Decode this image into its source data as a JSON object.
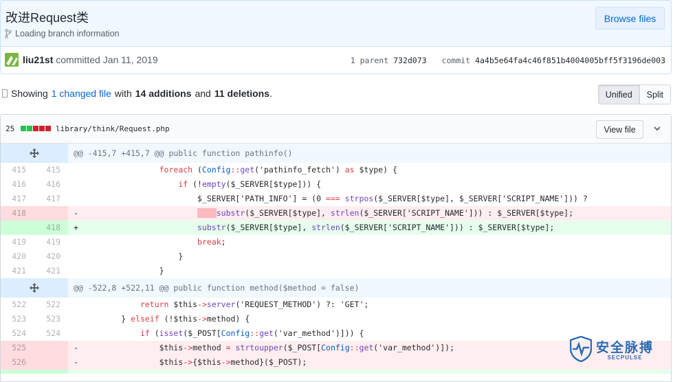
{
  "commit": {
    "title": "改进Request类",
    "branch_info": "Loading branch information",
    "browse_files": "Browse files",
    "author": "liu21st",
    "committed_text": "committed Jan 11, 2019",
    "parent_label": "1 parent",
    "parent_sha": "732d073",
    "commit_label": "commit",
    "commit_sha": "4a4b5e64fa4c46f851b4004005bff5f3196de003"
  },
  "toolbar": {
    "showing": "Showing",
    "changed_link": "1 changed file",
    "with": "with",
    "additions": "14 additions",
    "and": "and",
    "deletions": "11 deletions",
    "period": ".",
    "unified": "Unified",
    "split": "Split"
  },
  "file": {
    "change_count": "25",
    "path": "library/think/Request.php",
    "view_file": "View file",
    "diffstat_colors": [
      "#2cbe4e",
      "#2cbe4e",
      "#cb2431",
      "#cb2431",
      "#cb2431"
    ]
  },
  "hunks": {
    "h1": "@@ -415,7 +415,7 @@ public function pathinfo()",
    "h2": "@@ -522,8 +522,11 @@ public function method($method = false)"
  },
  "lines": {
    "l415a": "415",
    "l415b": "415",
    "l416a": "416",
    "l416b": "416",
    "l417a": "417",
    "l417b": "417",
    "l418a": "418",
    "l418b": "418",
    "l419a": "419",
    "l419b": "419",
    "l420a": "420",
    "l420b": "420",
    "l421a": "421",
    "l421b": "421",
    "l522a": "522",
    "l522b": "522",
    "l523a": "523",
    "l523b": "523",
    "l524a": "524",
    "l524b": "524",
    "l525a": "525",
    "l526a": "526",
    "minus": "-",
    "plus": "+"
  },
  "watermark": {
    "cn": "安全脉搏",
    "en": "SECPULSE"
  },
  "colors": {
    "link": "#0366d6",
    "del_bg": "#ffeef0",
    "add_bg": "#e6ffed",
    "hunk_bg": "#f1f8ff"
  }
}
